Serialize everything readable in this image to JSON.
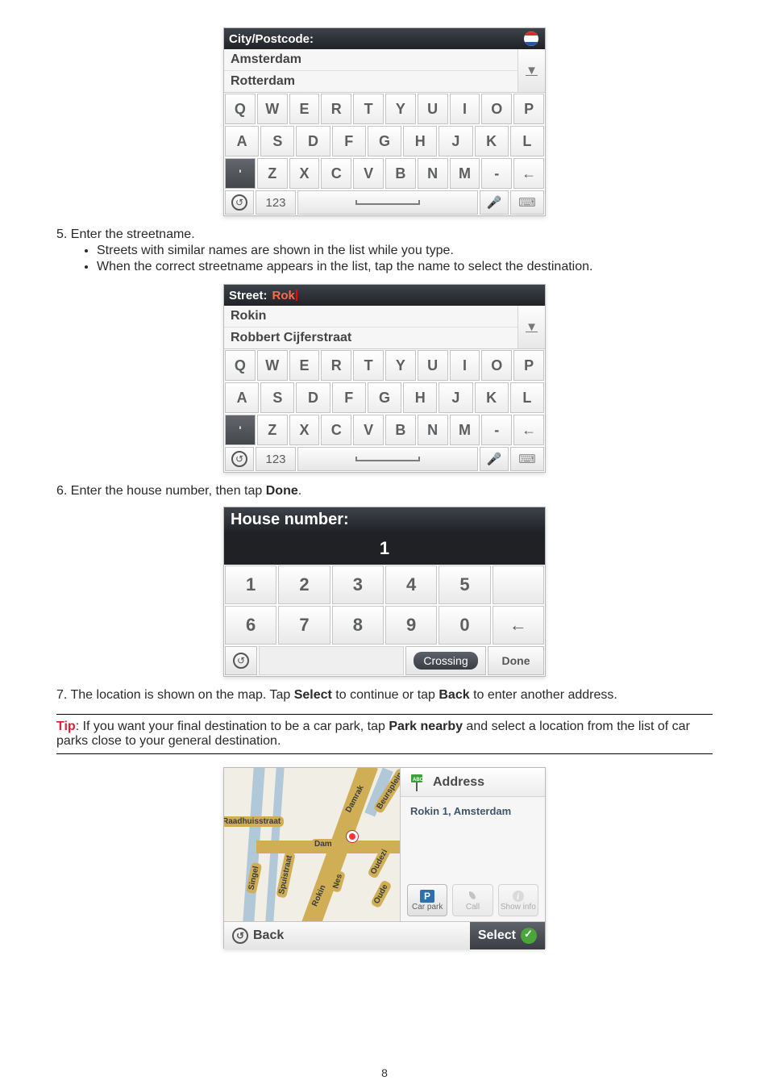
{
  "keyboard_image1": {
    "header_label": "City/Postcode:",
    "suggestions": [
      "Amsterdam",
      "Rotterdam"
    ],
    "row1": [
      "Q",
      "W",
      "E",
      "R",
      "T",
      "Y",
      "U",
      "I",
      "O",
      "P"
    ],
    "row2": [
      "A",
      "S",
      "D",
      "F",
      "G",
      "H",
      "J",
      "K",
      "L"
    ],
    "row3_punct": "'",
    "row3": [
      "Z",
      "X",
      "C",
      "V",
      "B",
      "N",
      "M",
      "-"
    ],
    "backspace": "←",
    "back_icon": "↺",
    "key_123": "123"
  },
  "step5": {
    "text": "5. Enter the streetname.",
    "bullet1": "Streets with similar names are shown in the list while you type.",
    "bullet2": "When the correct streetname appears in the list, tap the name to select the destination."
  },
  "keyboard_image2": {
    "header_label": "Street:",
    "header_value": "Rok",
    "suggestions": [
      "Rokin",
      "Robbert Cijferstraat"
    ],
    "row1": [
      "Q",
      "W",
      "E",
      "R",
      "T",
      "Y",
      "U",
      "I",
      "O",
      "P"
    ],
    "row2": [
      "A",
      "S",
      "D",
      "F",
      "G",
      "H",
      "J",
      "K",
      "L"
    ],
    "row3_punct": "'",
    "row3": [
      "Z",
      "X",
      "C",
      "V",
      "B",
      "N",
      "M",
      "-"
    ],
    "backspace": "←",
    "back_icon": "↺",
    "key_123": "123"
  },
  "step6": {
    "text_prefix": "6. Enter the house number, then tap ",
    "done_bold": "Done",
    "text_suffix": "."
  },
  "numpad": {
    "header": "House number:",
    "display": "1",
    "row1": [
      "1",
      "2",
      "3",
      "4",
      "5",
      ""
    ],
    "row2": [
      "6",
      "7",
      "8",
      "9",
      "0",
      "←"
    ],
    "back_icon": "↺",
    "crossing": "Crossing",
    "done": "Done"
  },
  "step7": {
    "text_prefix": "7. The location is shown on the map. Tap ",
    "select_bold": "Select",
    "mid": " to continue or tap ",
    "back_bold": "Back",
    "text_suffix": " to enter another address."
  },
  "tip": {
    "label": "Tip",
    "prefix": ": If you want your final destination to be a car park, tap ",
    "park_bold": "Park nearby",
    "suffix": " and select a location from the list of car parks close to your general destination."
  },
  "map": {
    "address_label": "Address",
    "address_text": "Rokin 1, Amsterdam",
    "car_park": "Car park",
    "call": "Call",
    "show_info": "Show info",
    "back": "Back",
    "select": "Select",
    "streets": {
      "s1": "Raadhuisstraat",
      "s2": "Singel",
      "s3": "Spuistraat",
      "s4": "Damrak",
      "s5": "Beursplein",
      "s6": "Dam",
      "s7": "Nes",
      "s8": "Rokin",
      "s9": "Oudezi",
      "s10": "Oude"
    }
  },
  "page_number": "8"
}
